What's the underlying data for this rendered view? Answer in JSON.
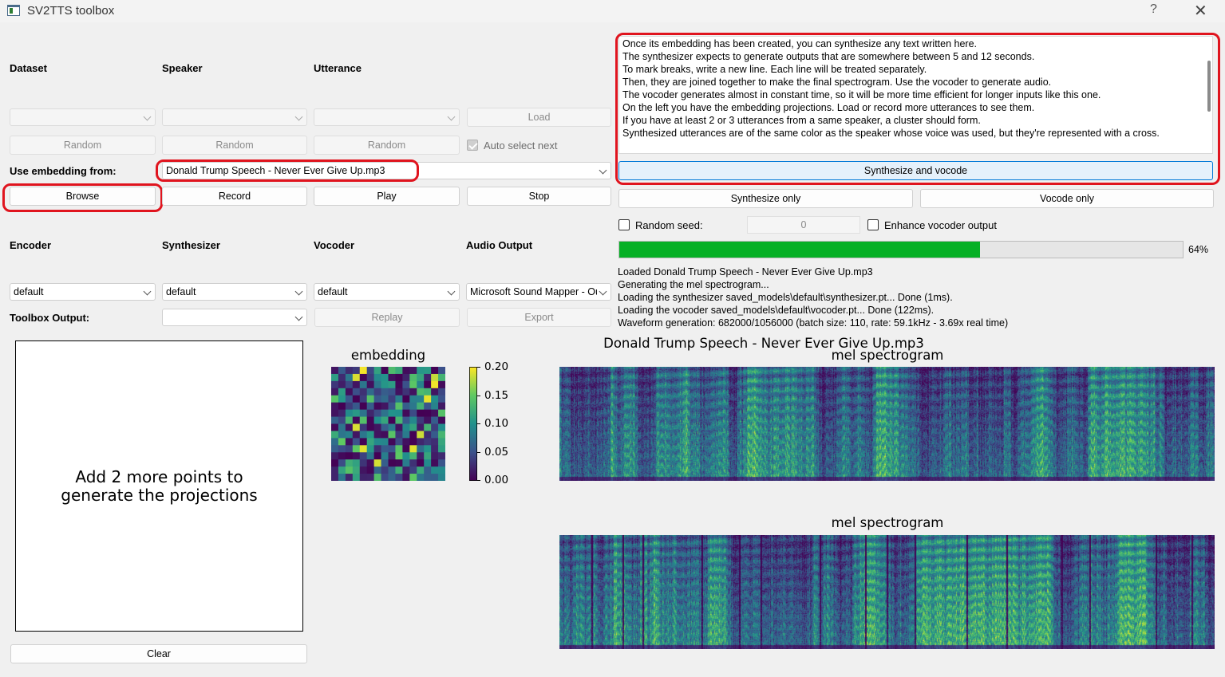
{
  "window": {
    "title": "SV2TTS toolbox",
    "help": "?",
    "close": "✕"
  },
  "dataset_section": {
    "dataset_label": "Dataset",
    "speaker_label": "Speaker",
    "utterance_label": "Utterance",
    "dataset_value": "",
    "speaker_value": "",
    "utterance_value": "",
    "load_label": "Load",
    "random_label": "Random",
    "auto_select_label": "Auto select next"
  },
  "embedding": {
    "label": "Use embedding from:",
    "value": "Donald Trump Speech - Never Ever Give Up.mp3",
    "browse": "Browse",
    "record": "Record",
    "play": "Play",
    "stop": "Stop"
  },
  "models": {
    "encoder_label": "Encoder",
    "synthesizer_label": "Synthesizer",
    "vocoder_label": "Vocoder",
    "audio_output_label": "Audio Output",
    "encoder_value": "default",
    "synthesizer_value": "default",
    "vocoder_value": "default",
    "audio_output_value": "Microsoft Sound Mapper - Output",
    "toolbox_output_label": "Toolbox Output:",
    "toolbox_output_value": "",
    "replay": "Replay",
    "export": "Export"
  },
  "text_input": {
    "lines": [
      "Once its embedding has been created, you can synthesize any text written here.",
      "The synthesizer expects to generate outputs that are somewhere between 5 and 12 seconds.",
      "To mark breaks, write a new line. Each line will be treated separately.",
      "Then, they are joined together to make the final spectrogram. Use the vocoder to generate audio.",
      "The vocoder generates almost in constant time, so it will be more time efficient for longer inputs like this one.",
      "On the left you have the embedding projections. Load or record more utterances to see them.",
      "If you have at least 2 or 3 utterances from a same speaker, a cluster should form.",
      "Synthesized utterances are of the same color as the speaker whose voice was used, but they're represented with a cross."
    ]
  },
  "generation": {
    "synthesize_vocode": "Synthesize and vocode",
    "synthesize_only": "Synthesize only",
    "vocode_only": "Vocode only",
    "random_seed_label": "Random seed:",
    "seed_value": "0",
    "enhance_label": "Enhance vocoder output",
    "progress_percent": 64,
    "progress_text": "64%"
  },
  "log": {
    "lines": [
      "Loaded Donald Trump Speech - Never Ever Give Up.mp3",
      "Generating the mel spectrogram...",
      "Loading the synthesizer saved_models\\default\\synthesizer.pt... Done (1ms).",
      "Loading the vocoder saved_models\\default\\vocoder.pt... Done (122ms).",
      "Waveform generation: 682000/1056000 (batch size: 110, rate: 59.1kHz - 3.69x real time)"
    ]
  },
  "projections": {
    "message": "Add 2 more points to\ngenerate the projections",
    "clear": "Clear"
  },
  "figures": {
    "embedding_title": "embedding",
    "colorbar_ticks": [
      "0.20",
      "0.15",
      "0.10",
      "0.05",
      "0.00"
    ],
    "colorbar_range": [
      0.0,
      0.2
    ],
    "main_title": "Donald Trump Speech - Never Ever Give Up.mp3",
    "mel_top_title": "mel spectrogram",
    "mel_bottom_title": "mel spectrogram",
    "colormap": [
      "#440154",
      "#3b528b",
      "#21918c",
      "#5ec962",
      "#fde725"
    ]
  }
}
